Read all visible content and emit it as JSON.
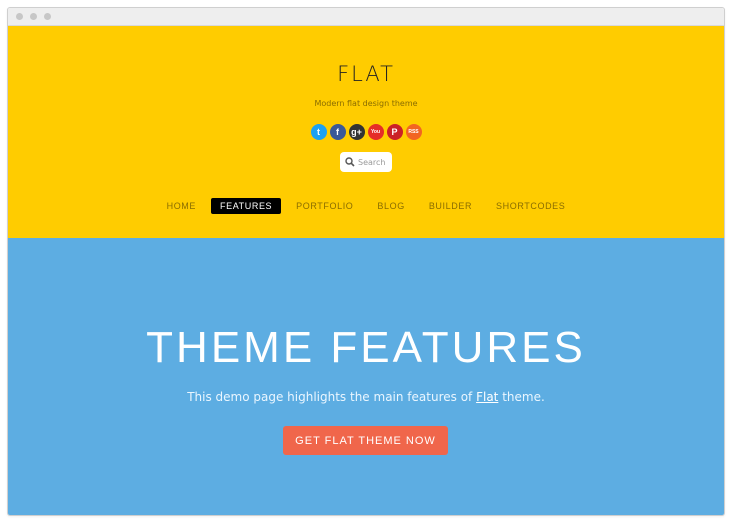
{
  "site": {
    "title": "FLAT",
    "tagline": "Modern flat design theme"
  },
  "social": [
    {
      "name": "twitter-icon",
      "glyph": "t",
      "color": "#1da1f2"
    },
    {
      "name": "facebook-icon",
      "glyph": "f",
      "color": "#3b5998"
    },
    {
      "name": "googleplus-icon",
      "glyph": "g+",
      "color": "#333333"
    },
    {
      "name": "youtube-icon",
      "glyph": "You",
      "color": "#e52d27"
    },
    {
      "name": "pinterest-icon",
      "glyph": "P",
      "color": "#cb2027"
    },
    {
      "name": "rss-icon",
      "glyph": "RSS",
      "color": "#f26522"
    }
  ],
  "search": {
    "placeholder": "Search"
  },
  "nav": {
    "items": [
      "HOME",
      "FEATURES",
      "PORTFOLIO",
      "BLOG",
      "BUILDER",
      "SHORTCODES"
    ],
    "active": "FEATURES"
  },
  "hero": {
    "title": "THEME FEATURES",
    "subtitle_prefix": "This demo page highlights the main features of ",
    "subtitle_link": "Flat",
    "subtitle_suffix": " theme.",
    "cta": "GET FLAT THEME NOW"
  },
  "colors": {
    "header_bg": "#ffcc00",
    "hero_bg": "#5dade2",
    "cta_bg": "#f0664b"
  }
}
